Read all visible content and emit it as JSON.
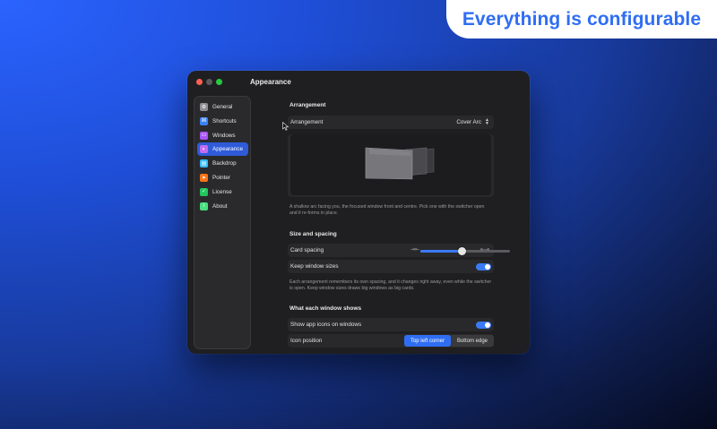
{
  "banner": {
    "text": "Everything is configurable"
  },
  "window": {
    "title": "Appearance"
  },
  "sidebar": {
    "items": [
      {
        "label": "General",
        "icon": "gear-icon",
        "color": "#8e8e93",
        "glyph": "⚙"
      },
      {
        "label": "Shortcuts",
        "icon": "command-icon",
        "color": "#3b82f6",
        "glyph": "⌘"
      },
      {
        "label": "Windows",
        "icon": "windows-icon",
        "color": "#a855f7",
        "glyph": "▭"
      },
      {
        "label": "Appearance",
        "icon": "appearance-icon",
        "color": "#c06cf0",
        "glyph": "◐",
        "active": true
      },
      {
        "label": "Backdrop",
        "icon": "backdrop-icon",
        "color": "#38bdf8",
        "glyph": "▤"
      },
      {
        "label": "Pointer",
        "icon": "pointer-icon",
        "color": "#f97316",
        "glyph": "➤"
      },
      {
        "label": "License",
        "icon": "license-icon",
        "color": "#22c55e",
        "glyph": "✓"
      },
      {
        "label": "About",
        "icon": "info-icon",
        "color": "#4ade80",
        "glyph": "i"
      }
    ]
  },
  "arrangement": {
    "section": "Arrangement",
    "label": "Arrangement",
    "value": "Cover Arc",
    "description": "A shallow arc facing you, the focused window front and centre. Pick one with the switcher open and it re-forms in place."
  },
  "size_spacing": {
    "section": "Size and spacing",
    "card_spacing_label": "Card spacing",
    "card_spacing_value": 0.46,
    "keep_sizes_label": "Keep window sizes",
    "keep_sizes_on": true,
    "description": "Each arrangement remembers its own spacing, and it changes right away, even while the switcher is open. Keep window sizes draws big windows as big cards."
  },
  "window_shows": {
    "section": "What each window shows",
    "show_icons_label": "Show app icons on windows",
    "show_icons_on": true,
    "icon_position_label": "Icon position",
    "icon_position_options": [
      "Top left corner",
      "Bottom edge"
    ],
    "icon_position_selected": "Top left corner"
  }
}
